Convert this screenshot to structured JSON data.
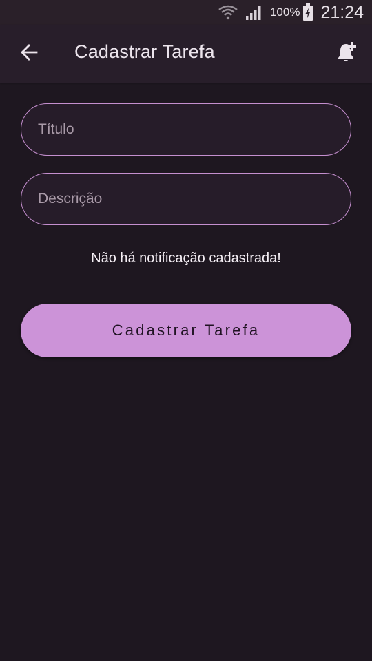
{
  "status_bar": {
    "battery_percent": "100%",
    "time": "21:24",
    "icons": [
      "wifi-icon",
      "signal-icon",
      "battery-charging-icon"
    ]
  },
  "app_bar": {
    "title": "Cadastrar Tarefa",
    "back_icon": "arrow-back-icon",
    "action_icon": "notification-add-icon"
  },
  "form": {
    "title_placeholder": "Título",
    "title_value": "",
    "description_placeholder": "Descrição",
    "description_value": "",
    "empty_notifications_text": "Não há notificação cadastrada!",
    "submit_label": "Cadastrar Tarefa"
  },
  "colors": {
    "background": "#1e1720",
    "app_bar": "#281e2a",
    "accent": "#cc93d8",
    "field_border": "#c58fcf"
  }
}
